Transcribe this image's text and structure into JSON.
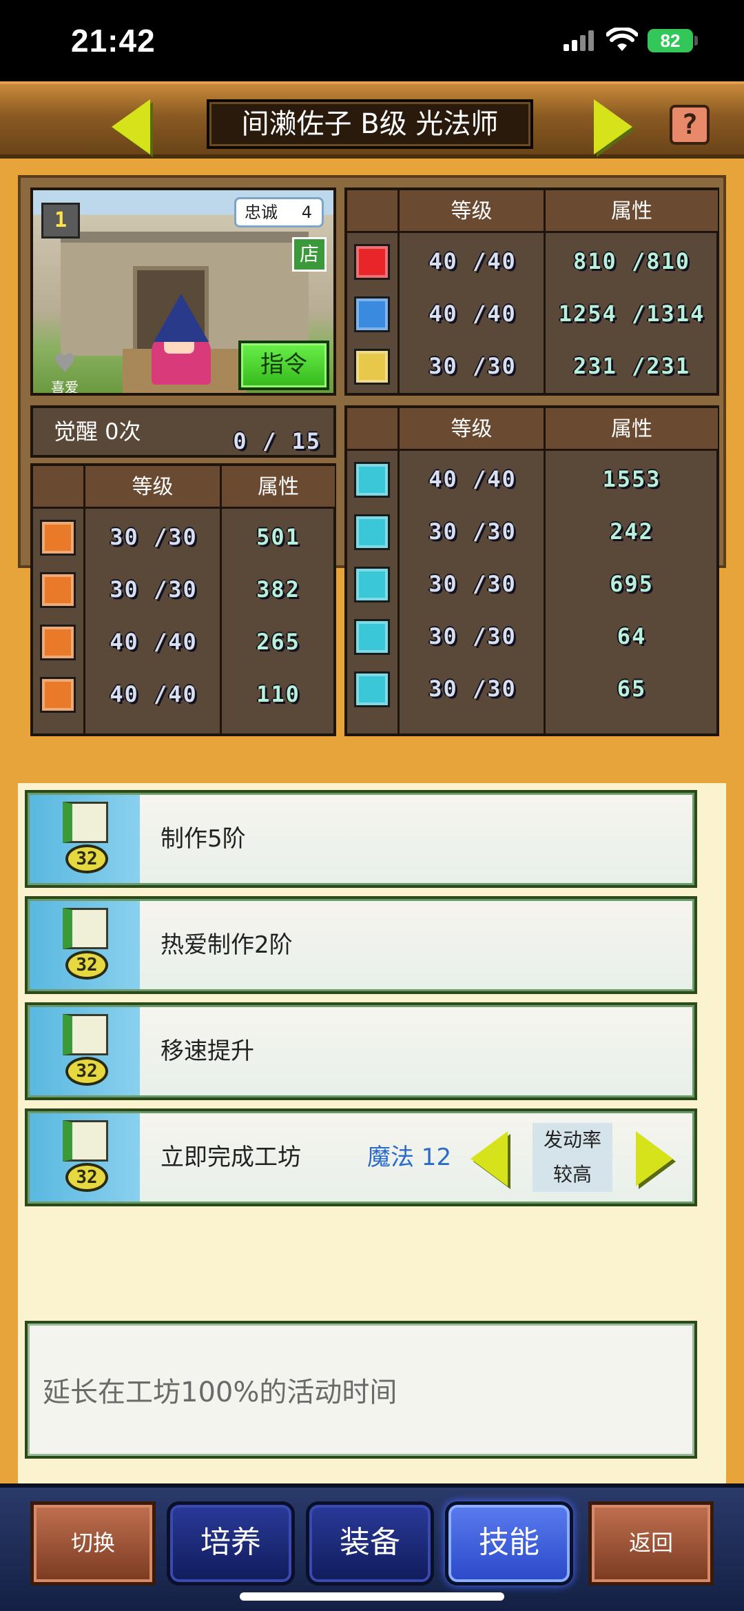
{
  "status_bar": {
    "time": "21:42",
    "battery": "82"
  },
  "header": {
    "title": "间濑佐子 B级 光法师",
    "help_label": "?"
  },
  "character": {
    "rank_badge": "1",
    "loyalty_label": "忠诚",
    "loyalty_value": "4",
    "shop_label": "店",
    "favorite_label": "喜爱",
    "command_label": "指令"
  },
  "vitals": {
    "headers": {
      "level": "等级",
      "attr": "属性"
    },
    "rows": [
      {
        "icon": "heart-icon",
        "icon_color": "#e8262a",
        "level": "40 /40",
        "attr": "810 /810"
      },
      {
        "icon": "potion-icon",
        "icon_color": "#3a8ae0",
        "level": "40 /40",
        "attr": "1254 /1314"
      },
      {
        "icon": "stamina-icon",
        "icon_color": "#e8c84a",
        "level": "30 /30",
        "attr": "231 /231"
      }
    ]
  },
  "awakening": {
    "label": "觉醒 0次",
    "count": "0 /  15"
  },
  "combat": {
    "headers": {
      "level": "等级",
      "attr": "属性"
    },
    "rows": [
      {
        "icon": "sword-icon",
        "icon_color": "#e87a2a",
        "level": "30 /30",
        "attr": "501"
      },
      {
        "icon": "shield-icon",
        "icon_color": "#e87a2a",
        "level": "30 /30",
        "attr": "382"
      },
      {
        "icon": "speed-icon",
        "icon_color": "#e87a2a",
        "level": "40 /40",
        "attr": "265"
      },
      {
        "icon": "star-icon",
        "icon_color": "#e87a2a",
        "level": "40 /40",
        "attr": "110"
      }
    ]
  },
  "crafting": {
    "headers": {
      "level": "等级",
      "attr": "属性"
    },
    "rows": [
      {
        "icon": "book-icon",
        "icon_color": "#3ac8d8",
        "level": "40 /40",
        "attr": "1553"
      },
      {
        "icon": "hammer-icon",
        "icon_color": "#3ac8d8",
        "level": "30 /30",
        "attr": "242"
      },
      {
        "icon": "shovel-icon",
        "icon_color": "#3ac8d8",
        "level": "30 /30",
        "attr": "695"
      },
      {
        "icon": "anvil-icon",
        "icon_color": "#3ac8d8",
        "level": "30 /30",
        "attr": "64"
      },
      {
        "icon": "hand-icon",
        "icon_color": "#3ac8d8",
        "level": "30 /30",
        "attr": "65"
      }
    ]
  },
  "skills": [
    {
      "name": "制作5阶",
      "level_badge": "32"
    },
    {
      "name": "热爱制作2阶",
      "level_badge": "32"
    },
    {
      "name": "移速提升",
      "level_badge": "32"
    },
    {
      "name": "立即完成工坊",
      "level_badge": "32",
      "magic": "魔法 12",
      "rate_line1": "发动率",
      "rate_line2": "较高"
    }
  ],
  "description": "延长在工坊100%的活动时间",
  "bottom_nav": {
    "switch": "切换",
    "train": "培养",
    "equip": "装备",
    "skill": "技能",
    "back": "返回"
  },
  "colors": {
    "accent_yellow": "#d6e21a",
    "nav_active": "#4a6ae8",
    "panel_brown": "#5a4838"
  }
}
